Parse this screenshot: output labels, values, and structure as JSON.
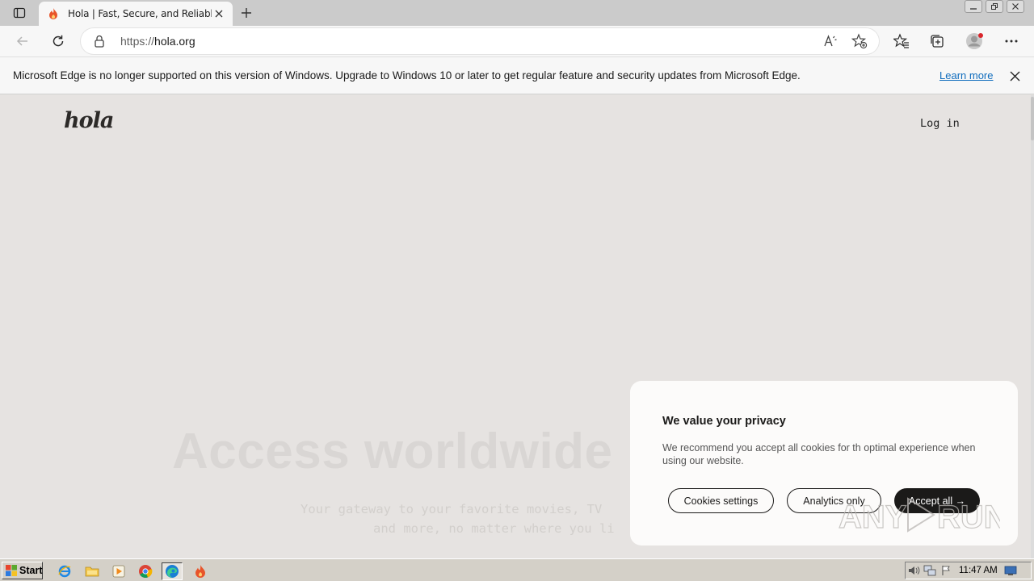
{
  "browser": {
    "tab": {
      "title": "Hola | Fast, Secure, and Reliable F"
    },
    "address": {
      "protocol": "https://",
      "host": "hola.org"
    }
  },
  "infobar": {
    "message": "Microsoft Edge is no longer supported on this version of Windows. Upgrade to Windows 10 or later to get regular feature and security updates from Microsoft Edge.",
    "link": "Learn more"
  },
  "page": {
    "logo": "hola",
    "login": "Log in",
    "hero_title": "Access worldwide",
    "hero_subtitle_line1": "Your gateway to your favorite movies, TV",
    "hero_subtitle_line2": "and more, no matter where you li"
  },
  "cookie": {
    "heading": "We value your privacy",
    "body": "We recommend you accept all cookies for th optimal experience when using our website.",
    "settings_label": "Cookies settings",
    "analytics_label": "Analytics only",
    "accept_label": "Accept all →"
  },
  "watermark": {
    "text": "ANY RUN"
  },
  "taskbar": {
    "start_label": "Start",
    "clock": "11:47 AM"
  },
  "colors": {
    "page_bg": "#e6e3e1",
    "accent_link": "#0f6cbd",
    "modal_dark": "#1b1a19",
    "favicon": "#e8542a"
  }
}
